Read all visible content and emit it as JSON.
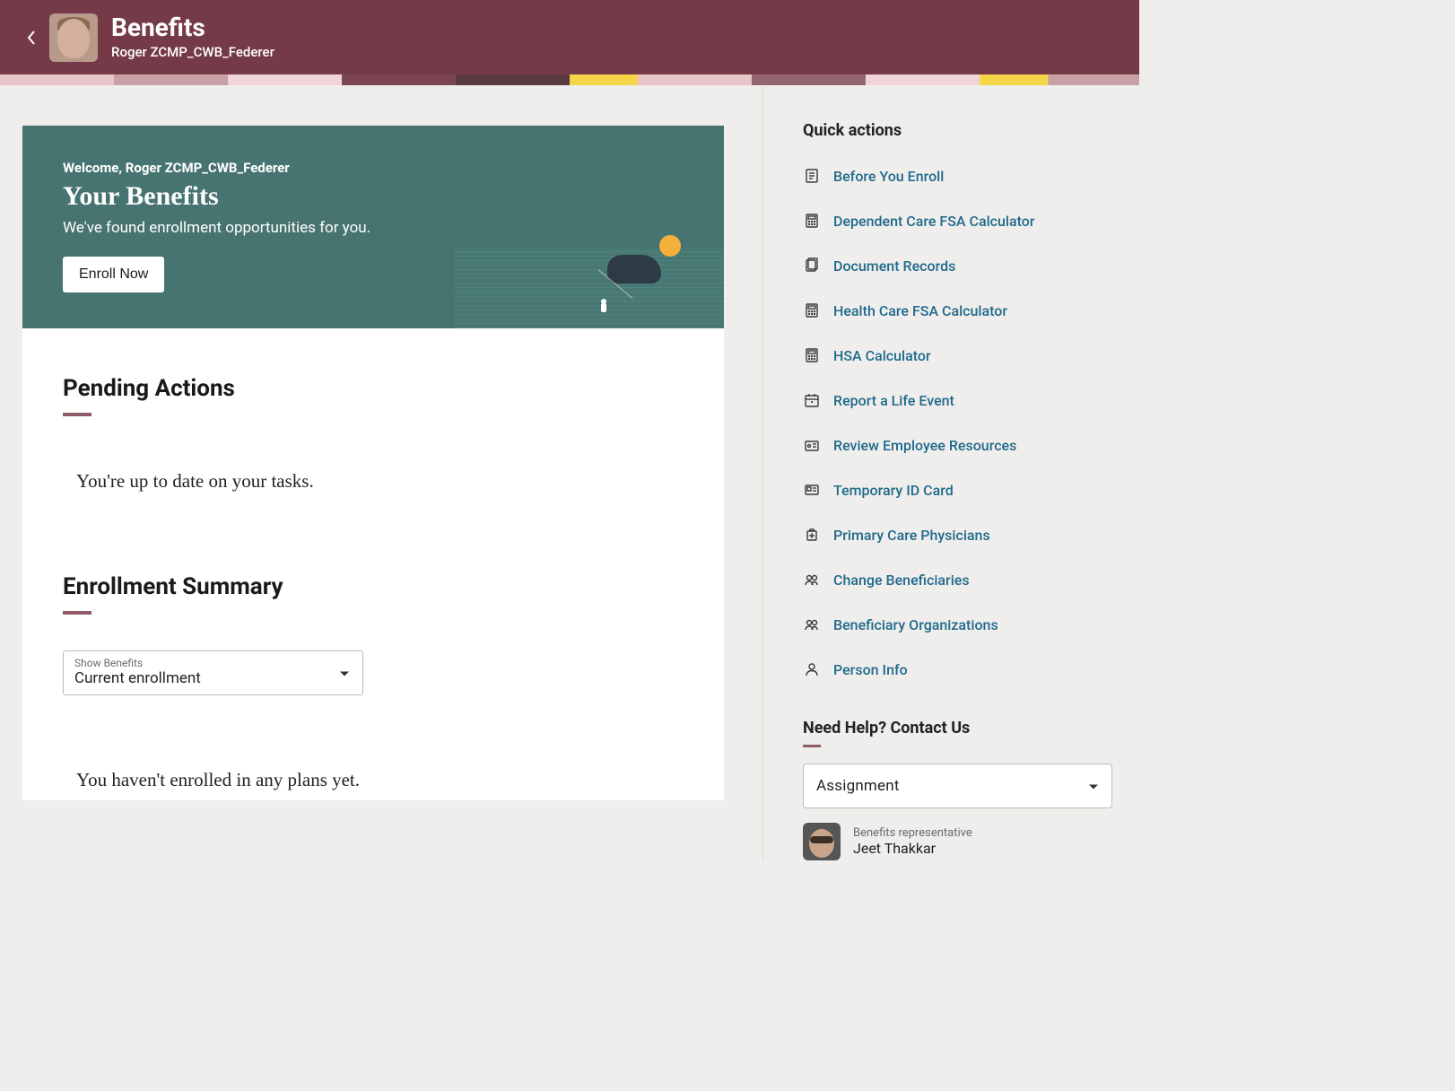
{
  "header": {
    "title": "Benefits",
    "subtitle": "Roger ZCMP_CWB_Federer"
  },
  "hero": {
    "welcome": "Welcome, Roger ZCMP_CWB_Federer",
    "title": "Your Benefits",
    "subtitle": "We've found enrollment opportunities for you.",
    "button": "Enroll Now"
  },
  "pending": {
    "title": "Pending Actions",
    "message": "You're up to date on your tasks."
  },
  "enrollment": {
    "title": "Enrollment Summary",
    "select_label": "Show Benefits",
    "select_value": "Current enrollment",
    "empty_message": "You haven't enrolled in any plans yet."
  },
  "quick_actions": {
    "title": "Quick actions",
    "items": [
      {
        "label": "Before You Enroll",
        "icon": "document"
      },
      {
        "label": "Dependent Care FSA Calculator",
        "icon": "calculator"
      },
      {
        "label": "Document Records",
        "icon": "records"
      },
      {
        "label": "Health Care FSA Calculator",
        "icon": "calculator"
      },
      {
        "label": "HSA Calculator",
        "icon": "calculator"
      },
      {
        "label": "Report a Life Event",
        "icon": "calendar"
      },
      {
        "label": "Review Employee Resources",
        "icon": "resources"
      },
      {
        "label": "Temporary ID Card",
        "icon": "idcard"
      },
      {
        "label": "Primary Care Physicians",
        "icon": "medical"
      },
      {
        "label": "Change Beneficiaries",
        "icon": "people"
      },
      {
        "label": "Beneficiary Organizations",
        "icon": "people"
      },
      {
        "label": "Person Info",
        "icon": "person"
      }
    ]
  },
  "help": {
    "title": "Need Help? Contact Us",
    "select_value": "Assignment",
    "rep_role": "Benefits representative",
    "rep_name": "Jeet Thakkar"
  }
}
